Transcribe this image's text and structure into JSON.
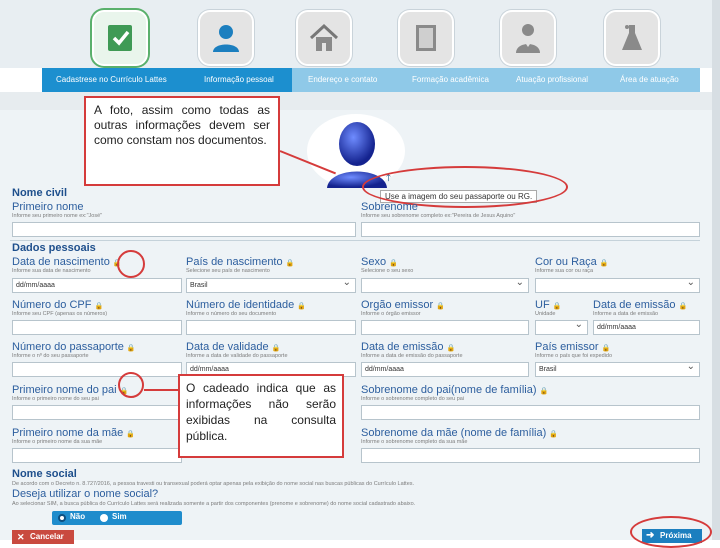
{
  "steps": [
    {
      "label": "Cadastrese no Currículo Lattes",
      "icon": "checklist-icon",
      "state": "done"
    },
    {
      "label": "Informação pessoal",
      "icon": "person-icon",
      "state": "current"
    },
    {
      "label": "Endereço e contato",
      "icon": "house-icon",
      "state": "pending"
    },
    {
      "label": "Formação acadêmica",
      "icon": "book-icon",
      "state": "pending"
    },
    {
      "label": "Atuação profissional",
      "icon": "professional-icon",
      "state": "pending"
    },
    {
      "label": "Área de atuação",
      "icon": "flask-icon",
      "state": "pending"
    }
  ],
  "photo": {
    "upload_hint": "Use a imagem do seu passaporte ou RG."
  },
  "callouts": {
    "photo_note": "A foto, assim como todas as outras informações devem ser como constam nos documentos.",
    "lock_note": "O cadeado indica que as informações não serão exibidas na consulta pública."
  },
  "nome_civil": {
    "title": "Nome civil",
    "primeiro_nome": {
      "label": "Primeiro nome",
      "hint": "Informe seu primeiro nome ex:\"José\""
    },
    "sobrenome": {
      "label": "Sobrenome",
      "hint": "Informe seu sobrenome completo ex:\"Pereira de Jesus Aquino\""
    }
  },
  "dados_pessoais": {
    "title": "Dados pessoais",
    "data_nascimento": {
      "label": "Data de nascimento",
      "hint": "Informe sua data de nascimento",
      "value": "dd/mm/aaaa"
    },
    "pais_nascimento": {
      "label": "País de nascimento",
      "hint": "Selecione seu país de nascimento",
      "value": "Brasil"
    },
    "sexo": {
      "label": "Sexo",
      "hint": "Selecione o seu sexo"
    },
    "cor_raca": {
      "label": "Cor ou Raça",
      "hint": "Informe sua cor ou raça"
    },
    "numero_cpf": {
      "label": "Número do CPF",
      "hint": "Informe seu CPF (apenas os números)"
    },
    "numero_identidade": {
      "label": "Número de identidade",
      "hint": "Informe o número do seu documento"
    },
    "orgao_emissor": {
      "label": "Orgão emissor",
      "hint": "Informe o órgão emissor"
    },
    "uf": {
      "label": "UF",
      "hint": "Unidade"
    },
    "data_emissao": {
      "label": "Data de emissão",
      "hint": "Informe a data de emissão",
      "value": "dd/mm/aaaa"
    },
    "numero_passaporte": {
      "label": "Número do passaporte",
      "hint": "Informe o nº do seu passaporte"
    },
    "data_validade": {
      "label": "Data de validade",
      "hint": "Informe a data de validade do passaporte",
      "value": "dd/mm/aaaa"
    },
    "data_emissao_passaporte": {
      "label": "Data de emissão",
      "hint": "Informe a data de emissão do passaporte",
      "value": "dd/mm/aaaa"
    },
    "pais_emissor": {
      "label": "País emissor",
      "hint": "Informe o país que foi expedido",
      "value": "Brasil"
    },
    "primeiro_nome_pai": {
      "label": "Primeiro nome do pai",
      "hint": "Informe o primeiro nome do seu pai"
    },
    "sobrenome_pai": {
      "label": "Sobrenome do pai(nome de família)",
      "hint": "Informe o sobrenome completo do seu pai"
    },
    "primeiro_nome_mae": {
      "label": "Primeiro nome da mãe",
      "hint": "Informe o primeiro nome da sua mãe"
    },
    "sobrenome_mae": {
      "label": "Sobrenome da mãe (nome de família)",
      "hint": "Informe o sobrenome completo da sua mãe"
    }
  },
  "nome_social": {
    "title": "Nome social",
    "note": "De acordo com o Decreto n. 8.727/2016, a pessoa travesti ou transexual poderá optar apenas pela exibição do nome social nas buscas públicas do Currículo Lattes.",
    "question": "Deseja utilizar o nome social?",
    "question_hint": "Ao selecionar SIM, a busca pública do Currículo Lattes será realizada somente a partir dos componentes (prenome e sobrenome) do nome social cadastrado abaixo.",
    "options": [
      "Não",
      "Sim"
    ],
    "selected": "Não"
  },
  "buttons": {
    "cancel": "Cancelar",
    "next": "Próxima"
  },
  "colors": {
    "accent": "#1c8fcf",
    "section_title": "#1e4f8c",
    "annotation_red": "#d53b3b"
  }
}
